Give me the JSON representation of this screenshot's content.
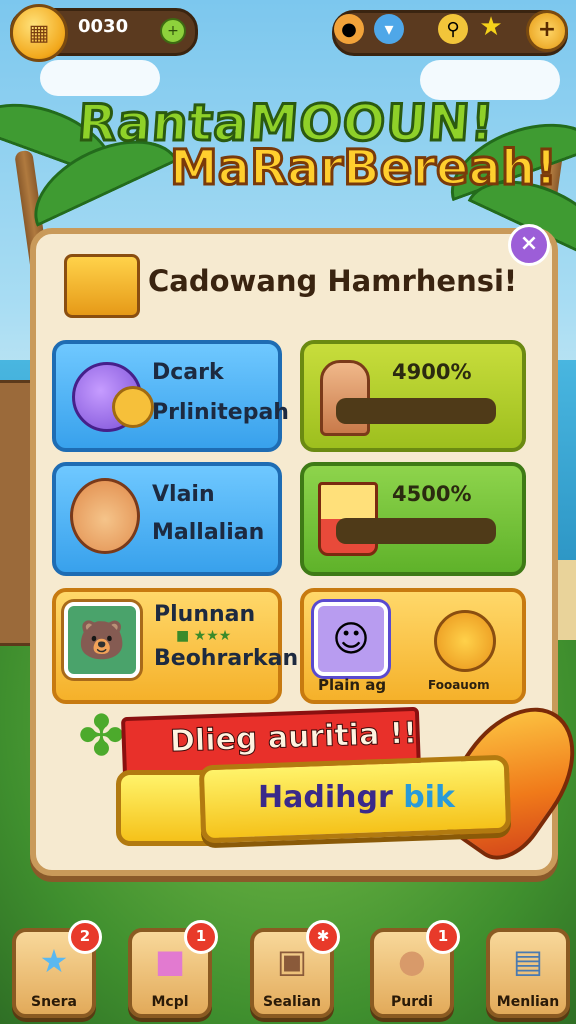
{
  "topbar": {
    "coins": "0030",
    "coin_plus": "+",
    "currency_plus": "+"
  },
  "title": {
    "line1": "RantaMOOUN!",
    "line2": "MaRarBereah!"
  },
  "panel": {
    "title": "Cadowang Hamrhensi!",
    "close": "×",
    "cards": [
      {
        "line1": "Dcark",
        "line2": "Prlinitepah",
        "color": "#4cb1f3"
      },
      {
        "pct_label": "4900%",
        "fill": 0.0,
        "color": "#b2cd2a"
      },
      {
        "line1": "Vlain",
        "line2": "Mallalian",
        "color": "#4cb1f3"
      },
      {
        "pct_label": "4500%",
        "fill": 0.0,
        "color": "#74c43a"
      },
      {
        "line1": "Plunnan",
        "line2": "Beohrarkan",
        "color": "#f5c44a"
      },
      {
        "label_left": "Plain ag",
        "label_right": "Fooauom",
        "color": "#f5c44a"
      }
    ]
  },
  "ribbon": {
    "text": "Dlieg auritia !!"
  },
  "cta": {
    "text_a": "Hadihgr",
    "text_b": "bik"
  },
  "bottom_nav": [
    {
      "label": "Snera",
      "badge": "2",
      "icon": "star-icon"
    },
    {
      "label": "Mcpl",
      "badge": "1",
      "icon": "gift-icon"
    },
    {
      "label": "Sealian",
      "badge": "✱",
      "icon": "box-icon"
    },
    {
      "label": "Purdi",
      "badge": "1",
      "icon": "pet-icon"
    },
    {
      "label": "Menlian",
      "badge": "",
      "icon": "machine-icon"
    }
  ]
}
